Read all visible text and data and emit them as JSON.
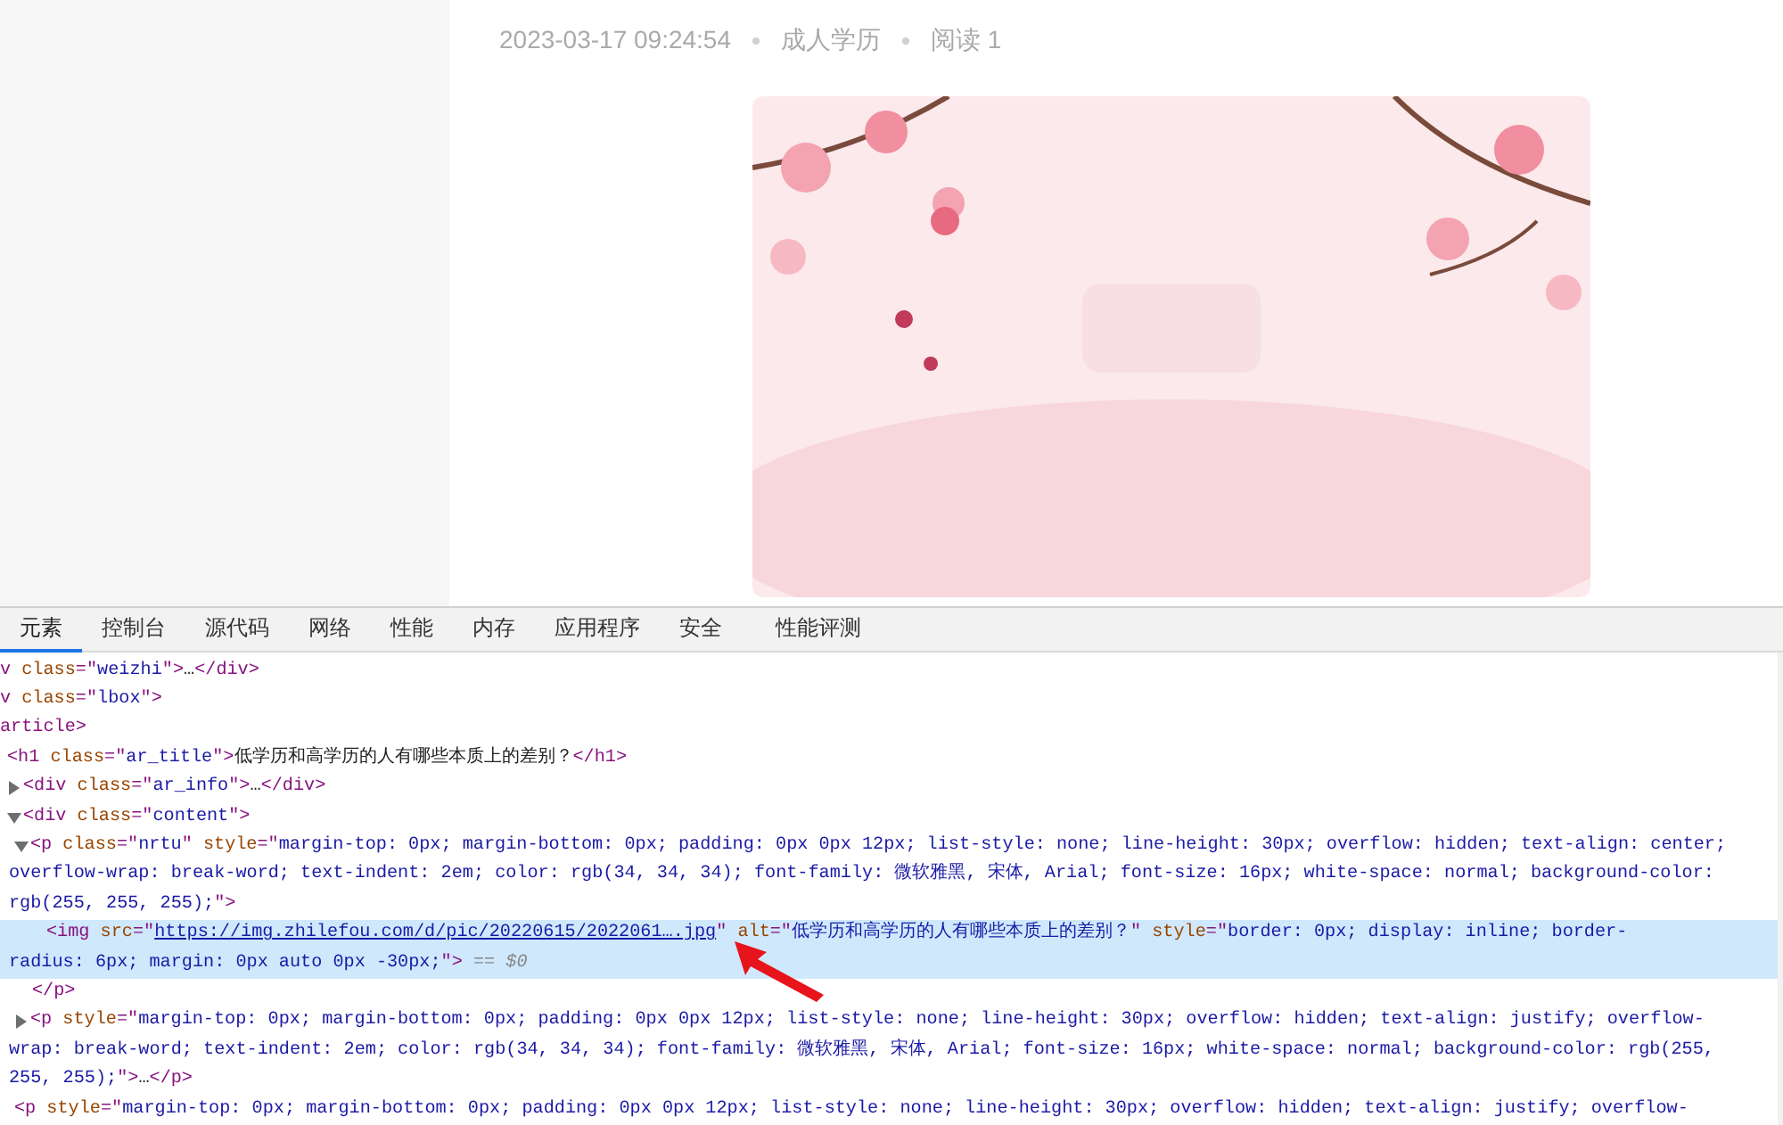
{
  "article": {
    "meta": [
      "2023-03-17 09:24:54",
      "成人学历",
      "阅读 1"
    ],
    "image": {
      "kind": "picture"
    }
  },
  "devtools": {
    "tabs": [
      {
        "label": "元素",
        "selected": true
      },
      {
        "label": "控制台",
        "selected": false
      },
      {
        "label": "源代码",
        "selected": false
      },
      {
        "label": "网络",
        "selected": false
      },
      {
        "label": "性能",
        "selected": false
      },
      {
        "label": "内存",
        "selected": false
      },
      {
        "label": "应用程序",
        "selected": false
      },
      {
        "label": "安全",
        "selected": false
      },
      {
        "label": "性能评测",
        "selected": false
      }
    ],
    "tree": [
      {
        "lines": [
          {
            "segments": [
              {
                "kind": "tag",
                "text": "v "
              },
              {
                "kind": "attr",
                "text": "class"
              },
              {
                "kind": "tag",
                "text": "=\""
              },
              {
                "kind": "val",
                "text": "weizhi"
              },
              {
                "kind": "tag",
                "text": "\">"
              },
              {
                "kind": "text",
                "text": "…"
              },
              {
                "kind": "tag",
                "text": "</div>"
              }
            ]
          }
        ]
      },
      {
        "lines": [
          {
            "segments": [
              {
                "kind": "tag",
                "text": "v "
              },
              {
                "kind": "attr",
                "text": "class"
              },
              {
                "kind": "tag",
                "text": "=\""
              },
              {
                "kind": "val",
                "text": "lbox"
              },
              {
                "kind": "tag",
                "text": "\">"
              }
            ]
          }
        ],
        "children": [
          {
            "lines": [
              {
                "segments": [
                  {
                    "kind": "tag",
                    "text": "article>"
                  }
                ]
              }
            ],
            "children": [
              {
                "lines": [
                  {
                    "segments": [
                      {
                        "kind": "tag",
                        "text": "<h1 "
                      },
                      {
                        "kind": "attr",
                        "text": "class"
                      },
                      {
                        "kind": "tag",
                        "text": "=\""
                      },
                      {
                        "kind": "val",
                        "text": "ar_title"
                      },
                      {
                        "kind": "tag",
                        "text": "\">"
                      },
                      {
                        "kind": "text",
                        "text": "低学历和高学历的人有哪些本质上的差别？"
                      },
                      {
                        "kind": "tag",
                        "text": "</h1>"
                      }
                    ]
                  }
                ]
              },
              {
                "expanded": false,
                "lines": [
                  {
                    "segments": [
                      {
                        "kind": "tag",
                        "text": "<div "
                      },
                      {
                        "kind": "attr",
                        "text": "class"
                      },
                      {
                        "kind": "tag",
                        "text": "=\""
                      },
                      {
                        "kind": "val",
                        "text": "ar_info"
                      },
                      {
                        "kind": "tag",
                        "text": "\">"
                      },
                      {
                        "kind": "text",
                        "text": "…"
                      },
                      {
                        "kind": "tag",
                        "text": "</div>"
                      }
                    ]
                  }
                ]
              },
              {
                "expanded": true,
                "lines": [
                  {
                    "segments": [
                      {
                        "kind": "tag",
                        "text": "<div "
                      },
                      {
                        "kind": "attr",
                        "text": "class"
                      },
                      {
                        "kind": "tag",
                        "text": "=\""
                      },
                      {
                        "kind": "val",
                        "text": "content"
                      },
                      {
                        "kind": "tag",
                        "text": "\">"
                      }
                    ]
                  }
                ],
                "children": [
                  {
                    "expanded": true,
                    "close": "</p>",
                    "lines": [
                      {
                        "segments": [
                          {
                            "kind": "tag",
                            "text": "<p "
                          },
                          {
                            "kind": "attr",
                            "text": "class"
                          },
                          {
                            "kind": "tag",
                            "text": "=\""
                          },
                          {
                            "kind": "val",
                            "text": "nrtu"
                          },
                          {
                            "kind": "tag",
                            "text": "\" "
                          },
                          {
                            "kind": "attr",
                            "text": "style"
                          },
                          {
                            "kind": "tag",
                            "text": "=\""
                          },
                          {
                            "kind": "val",
                            "text": "margin-top: 0px; margin-bottom: 0px; padding: 0px 0px 12px; list-style: none; line-height: 30px; overflow: hidden; text-align: center;"
                          }
                        ]
                      },
                      {
                        "segments": [
                          {
                            "kind": "val",
                            "text": "overflow-wrap: break-word; text-indent: 2em; color: rgb(34, 34, 34); font-family: 微软雅黑, 宋体, Arial; font-size: 16px; white-space: normal; background-color:"
                          }
                        ]
                      },
                      {
                        "segments": [
                          {
                            "kind": "val",
                            "text": "rgb(255, 255, 255);"
                          },
                          {
                            "kind": "tag",
                            "text": "\">"
                          }
                        ]
                      }
                    ],
                    "children": [
                      {
                        "selected": true,
                        "lines": [
                          {
                            "segments": [
                              {
                                "kind": "tag",
                                "text": "<img "
                              },
                              {
                                "kind": "attr",
                                "text": "src"
                              },
                              {
                                "kind": "tag",
                                "text": "=\""
                              },
                              {
                                "kind": "link",
                                "text": "https://img.zhilefou.com/d/pic/20220615/2022061….jpg"
                              },
                              {
                                "kind": "tag",
                                "text": "\" "
                              },
                              {
                                "kind": "attr",
                                "text": "alt"
                              },
                              {
                                "kind": "tag",
                                "text": "=\""
                              },
                              {
                                "kind": "val",
                                "text": "低学历和高学历的人有哪些本质上的差别？"
                              },
                              {
                                "kind": "tag",
                                "text": "\" "
                              },
                              {
                                "kind": "attr",
                                "text": "style"
                              },
                              {
                                "kind": "tag",
                                "text": "=\""
                              },
                              {
                                "kind": "val",
                                "text": "border: 0px; display: inline; border-"
                              }
                            ]
                          },
                          {
                            "segments": [
                              {
                                "kind": "val",
                                "text": "radius: 6px; margin: 0px auto 0px -30px;"
                              },
                              {
                                "kind": "tag",
                                "text": "\">"
                              },
                              {
                                "kind": "dim",
                                "text": " == $0"
                              }
                            ]
                          }
                        ]
                      }
                    ]
                  },
                  {
                    "expanded": false,
                    "lines": [
                      {
                        "segments": [
                          {
                            "kind": "tag",
                            "text": "<p "
                          },
                          {
                            "kind": "attr",
                            "text": "style"
                          },
                          {
                            "kind": "tag",
                            "text": "=\""
                          },
                          {
                            "kind": "val",
                            "text": "margin-top: 0px; margin-bottom: 0px; padding: 0px 0px 12px; list-style: none; line-height: 30px; overflow: hidden; text-align: justify; overflow-"
                          }
                        ]
                      },
                      {
                        "segments": [
                          {
                            "kind": "val",
                            "text": "wrap: break-word; text-indent: 2em; color: rgb(34, 34, 34); font-family: 微软雅黑, 宋体, Arial; font-size: 16px; white-space: normal; background-color: rgb(255,"
                          }
                        ]
                      },
                      {
                        "segments": [
                          {
                            "kind": "val",
                            "text": "255, 255);"
                          },
                          {
                            "kind": "tag",
                            "text": "\">"
                          },
                          {
                            "kind": "text",
                            "text": "…"
                          },
                          {
                            "kind": "tag",
                            "text": "</p>"
                          }
                        ]
                      }
                    ]
                  },
                  {
                    "lines": [
                      {
                        "segments": [
                          {
                            "kind": "tag",
                            "text": "<p "
                          },
                          {
                            "kind": "attr",
                            "text": "style"
                          },
                          {
                            "kind": "tag",
                            "text": "=\""
                          },
                          {
                            "kind": "val",
                            "text": "margin-top: 0px; margin-bottom: 0px; padding: 0px 0px 12px; list-style: none; line-height: 30px; overflow: hidden; text-align: justify; overflow-"
                          }
                        ]
                      }
                    ]
                  }
                ]
              }
            ]
          }
        ]
      }
    ]
  }
}
